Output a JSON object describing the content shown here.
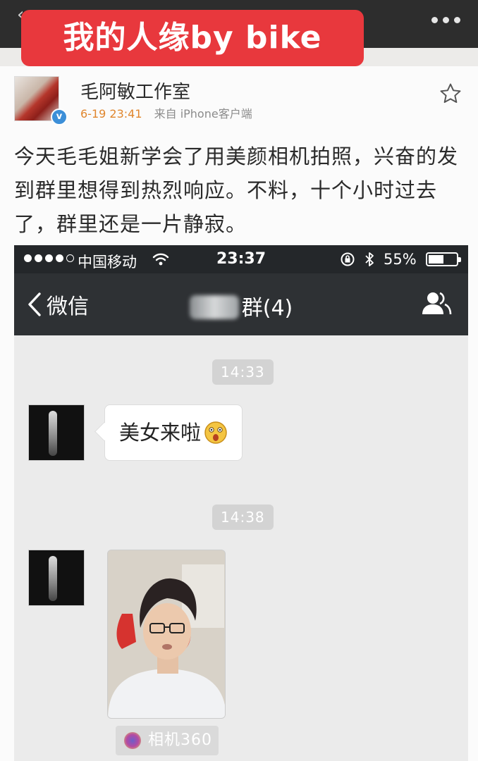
{
  "overlay": {
    "banner": "我的人缘by bike"
  },
  "post": {
    "author": "毛阿敏工作室",
    "time": "6-19 23:41",
    "source": "来自 iPhone客户端",
    "text": "今天毛毛姐新学会了用美颜相机拍照，兴奋的发到群里想得到热烈响应。不料，十个小时过去了，群里还是一片静寂。"
  },
  "screenshot": {
    "status": {
      "carrier": "中国移动",
      "clock": "23:37",
      "battery": "55%",
      "battery_level": 0.55
    },
    "nav": {
      "back_label": "微信",
      "group_suffix": "群(4)"
    },
    "messages": {
      "time1": "14:33",
      "text1": "美女来啦",
      "time2": "14:38",
      "app_tag": "相机360"
    }
  },
  "colors": {
    "banner": "#e8383d",
    "verified": "#3c8fd8",
    "time": "#e0862d"
  }
}
